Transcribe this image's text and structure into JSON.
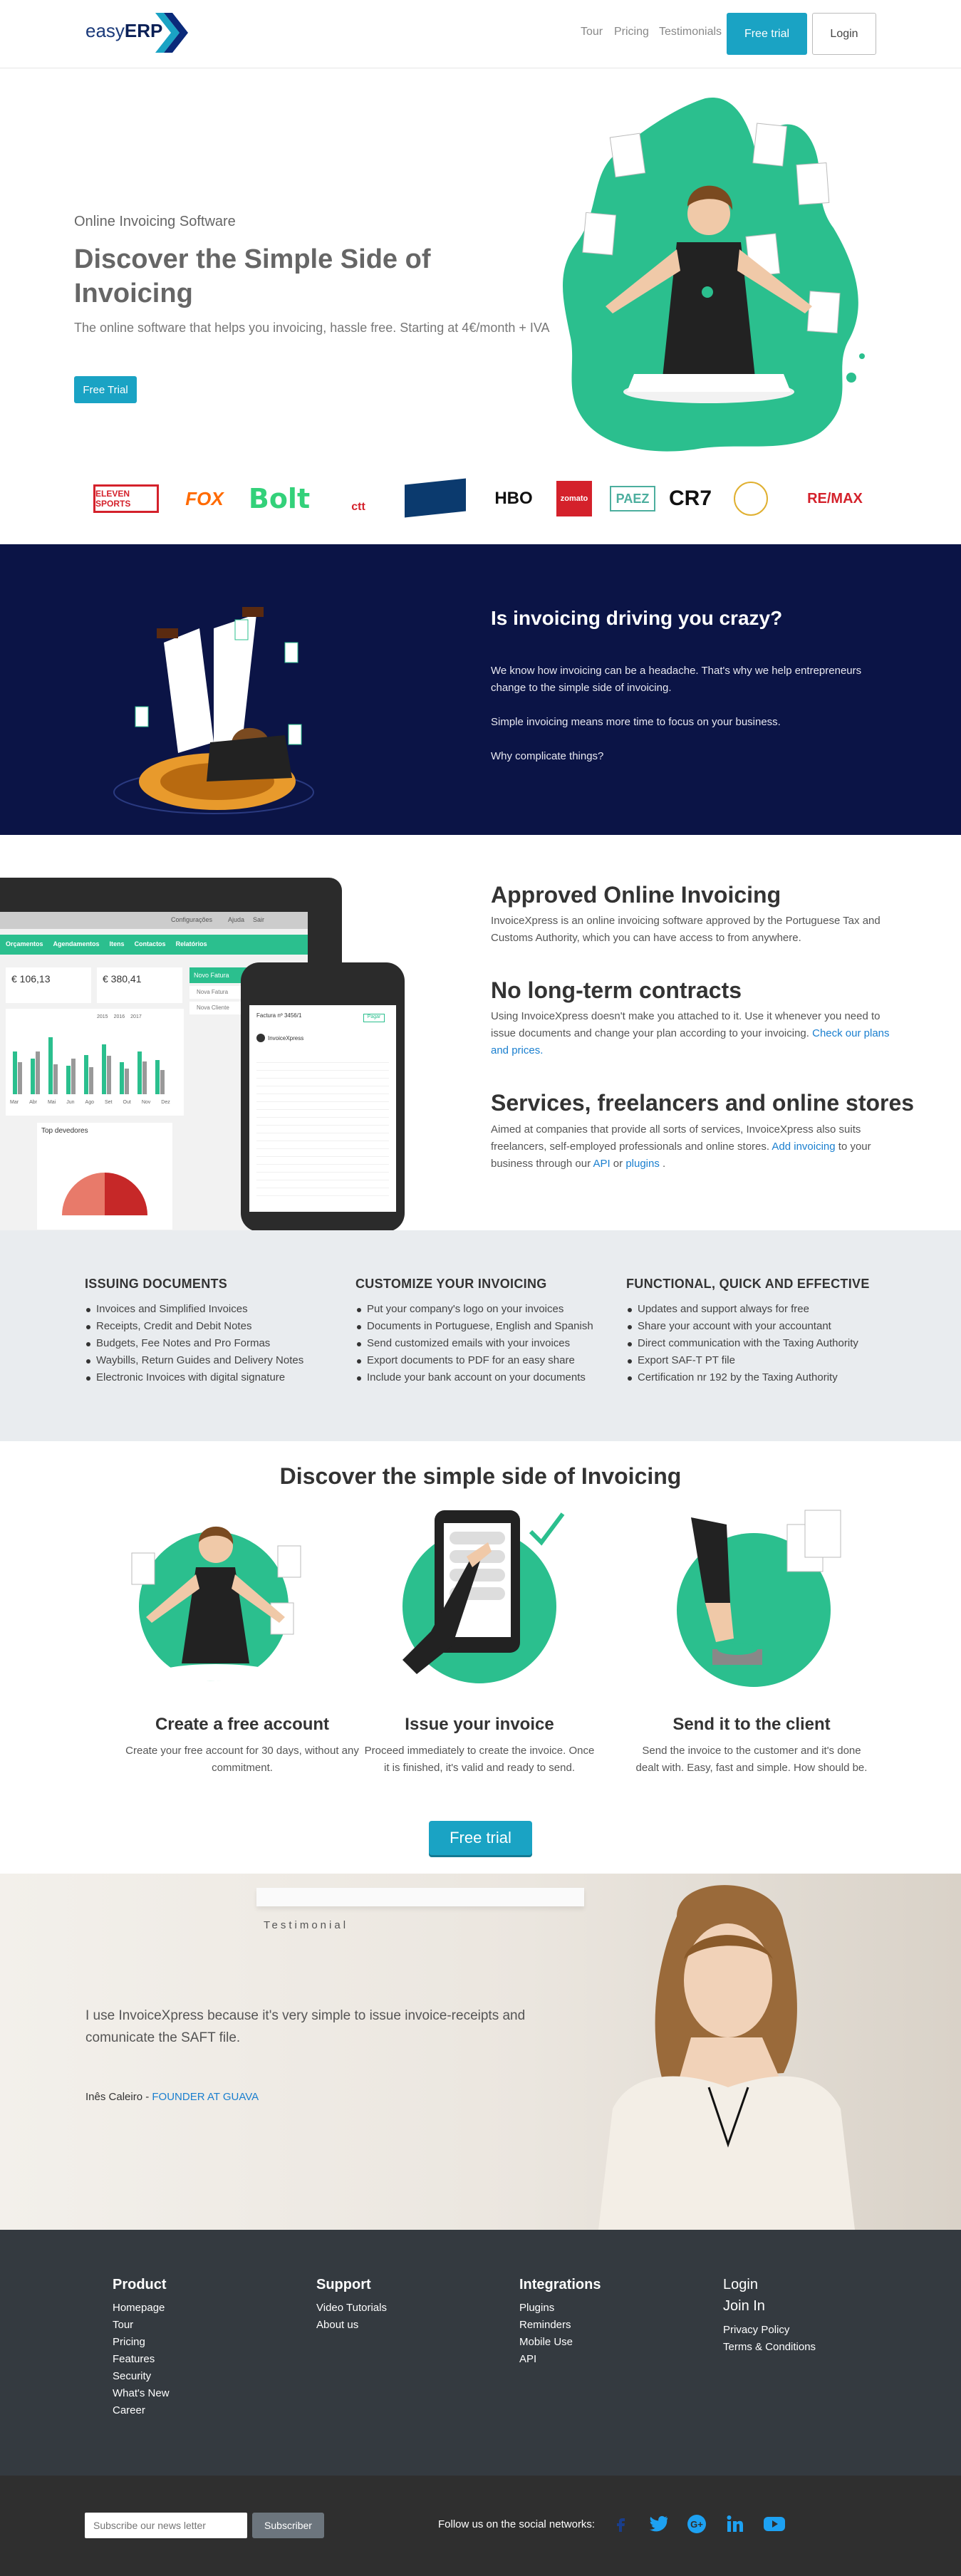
{
  "header": {
    "logo_easy": "easy",
    "logo_erp": "ERP",
    "nav": [
      "Tour",
      "Pricing",
      "Testimonials"
    ],
    "trial_label": "Free trial",
    "login_label": "Login"
  },
  "hero": {
    "eyebrow": "Online Invoicing Software",
    "title": "Discover the Simple Side of Invoicing",
    "subtitle": "The online software that helps you invoicing, hassle free. Starting at 4€/month + IVA",
    "cta": "Free Trial"
  },
  "clients": [
    "ELEVEN SPORTS",
    "FOX",
    "Bolt",
    "ctt",
    "",
    "HBO",
    "zomato",
    "PAEZ",
    "CR7",
    "",
    "RE/MAX"
  ],
  "crazy": {
    "title": "Is invoicing driving you crazy?",
    "p1": "We know how invoicing can be a headache. That's why we help entrepreneurs change to the simple side of invoicing.",
    "p2": "Simple invoicing means more time to focus on your business.",
    "p3": "Why complicate things?"
  },
  "mock": {
    "nav": [
      "Orçamentos",
      "Agendamentos",
      "Itens",
      "Contactos",
      "Relatórios"
    ],
    "top_items": [
      "Configurações",
      "Ajuda",
      "Sair"
    ],
    "stat1": "€ 106,13",
    "stat2": "€ 380,41",
    "panel": "Novo Fatura",
    "panel_items": [
      "Nova Fatura",
      "Nova Cliente"
    ],
    "months": [
      "Mar",
      "Abr",
      "Mai",
      "Jun",
      "Ago",
      "Set",
      "Out",
      "Nov",
      "Dez"
    ],
    "legend": [
      "2015",
      "2016",
      "2017"
    ],
    "debtors": "Top devedores",
    "phone_title": "Factura nº 3456/1",
    "phone_btn": "Pagar",
    "phone_company": "InvoiceXpress"
  },
  "features": [
    {
      "title": "Approved Online Invoicing",
      "text": "InvoiceXpress is an online invoicing software approved by the Portuguese Tax and Customs Authority, which you can have access to from anywhere."
    },
    {
      "title": "No long-term contracts",
      "text": "Using InvoiceXpress doesn't make you attached to it. Use it whenever you need to issue documents and change your plan according to your invoicing.",
      "link": "Check our plans and prices."
    },
    {
      "title": "Services, freelancers and online stores",
      "text": "Aimed at companies that provide all sorts of services, InvoiceXpress also suits freelancers, self-employed professionals and online stores.",
      "link1": "Add invoicing",
      "mid1": " to your business through our ",
      "link2": "API",
      "mid2": " or ",
      "link3": "plugins",
      "end": " ."
    }
  ],
  "columns": [
    {
      "title": "ISSUING DOCUMENTS",
      "items": [
        "Invoices and Simplified Invoices",
        "Receipts, Credit and Debit Notes",
        "Budgets, Fee Notes and Pro Formas",
        "Waybills, Return Guides and Delivery Notes",
        "Electronic Invoices with digital signature"
      ]
    },
    {
      "title": "CUSTOMIZE YOUR INVOICING",
      "items": [
        "Put your company's logo on your invoices",
        "Documents in Portuguese, English and Spanish",
        "Send customized emails with your invoices",
        "Export documents to PDF for an easy share",
        "Include your bank account on your documents"
      ]
    },
    {
      "title": "FUNCTIONAL, QUICK AND EFFECTIVE",
      "items": [
        "Updates and support always for free",
        "Share your account with your accountant",
        "Direct communication with the Taxing Authority",
        "Export SAF-T PT file",
        "Certification nr 192 by the Taxing Authority"
      ]
    }
  ],
  "discover": {
    "title": "Discover the simple side of Invoicing",
    "steps": [
      {
        "title": "Create a free account",
        "text": "Create your free account for 30 days, without any commitment."
      },
      {
        "title": "Issue your invoice",
        "text": "Proceed immediately to create the invoice. Once it is finished, it's valid and ready to send."
      },
      {
        "title": "Send it to the client",
        "text": "Send the invoice to the customer and it's done dealt with. Easy, fast and simple. How should be."
      }
    ],
    "cta": "Free trial"
  },
  "testimonial": {
    "label": "Testimonial",
    "quote": "I use InvoiceXpress because it's very simple to issue invoice-receipts and comunicate the SAFT file.",
    "author": "Inês Caleiro",
    "sep": " - ",
    "role": "FOUNDER AT GUAVA"
  },
  "footer": {
    "cols": [
      {
        "title": "Product",
        "items": [
          "Homepage",
          "Tour",
          "Pricing",
          "Features",
          "Security",
          "What's New",
          "Career"
        ]
      },
      {
        "title": "Support",
        "items": [
          "Video Tutorials",
          "About us"
        ]
      },
      {
        "title": "Integrations",
        "items": [
          "Plugins",
          "Reminders",
          "Mobile Use",
          "API"
        ]
      },
      {
        "title": "Login",
        "title2": "Join In",
        "items": [
          "Privacy Policy",
          "Terms & Conditions"
        ]
      }
    ],
    "newsletter_placeholder": "Subscribe our news letter",
    "subscribe": "Subscriber",
    "follow": "Follow us on the social networks:",
    "social": [
      "facebook-icon",
      "twitter-icon",
      "google-plus-icon",
      "linkedin-icon",
      "youtube-icon"
    ]
  },
  "colors": {
    "accent": "#1aa3c4",
    "green": "#2bbf8e",
    "navy": "#0b1446",
    "footer": "#343a40",
    "link": "#1a7fcf"
  }
}
